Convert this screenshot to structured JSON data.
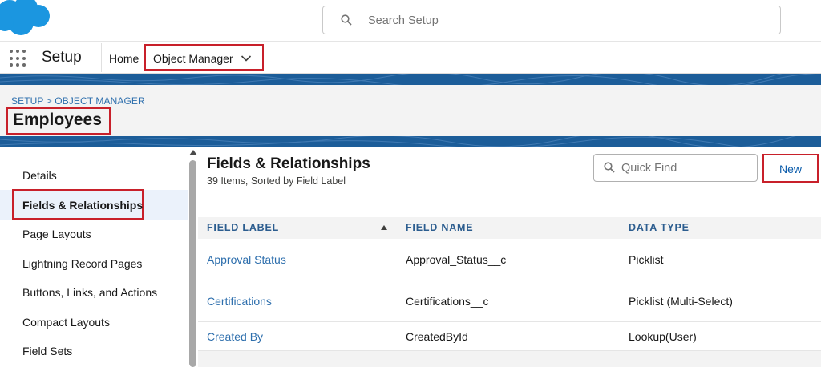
{
  "search": {
    "placeholder": "Search Setup"
  },
  "nav": {
    "app_name": "Setup",
    "home": "Home",
    "object_manager": "Object Manager"
  },
  "breadcrumb": {
    "text": "SETUP > OBJECT MANAGER"
  },
  "page": {
    "title": "Employees"
  },
  "sidebar": {
    "items": [
      {
        "label": "Details"
      },
      {
        "label": "Fields & Relationships",
        "selected": true
      },
      {
        "label": "Page Layouts"
      },
      {
        "label": "Lightning Record Pages"
      },
      {
        "label": "Buttons, Links, and Actions"
      },
      {
        "label": "Compact Layouts"
      },
      {
        "label": "Field Sets"
      }
    ]
  },
  "section": {
    "title": "Fields & Relationships",
    "subtitle": "39 Items, Sorted by Field Label"
  },
  "quick_find": {
    "placeholder": "Quick Find"
  },
  "toolbar": {
    "new_label": "New"
  },
  "table": {
    "columns": [
      "FIELD LABEL",
      "FIELD NAME",
      "DATA TYPE"
    ],
    "rows": [
      {
        "label": "Approval Status",
        "name": "Approval_Status__c",
        "type": "Picklist"
      },
      {
        "label": "Certifications",
        "name": "Certifications__c",
        "type": "Picklist (Multi-Select)"
      },
      {
        "label": "Created By",
        "name": "CreatedById",
        "type": "Lookup(User)"
      }
    ]
  },
  "colors": {
    "brand_blue": "#1c5d99",
    "link_blue": "#2e6fad",
    "highlight_red": "#c8202a",
    "logo_blue": "#1b96e0"
  },
  "icons": [
    "salesforce-cloud-logo",
    "search-icon",
    "app-launcher-icon",
    "chevron-down-icon",
    "sort-ascending-icon"
  ]
}
